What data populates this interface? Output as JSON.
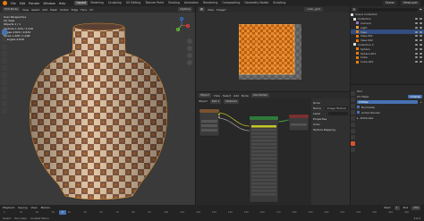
{
  "app": {
    "menu": [
      "File",
      "Edit",
      "Render",
      "Window",
      "Help"
    ],
    "tabs": [
      "Layout",
      "Modeling",
      "Sculpting",
      "UV Editing",
      "Texture Paint",
      "Shading",
      "Animation",
      "Rendering",
      "Compositing",
      "Geometry Nodes",
      "Scripting"
    ],
    "active_tab": "Layout",
    "scene": "Scene",
    "view_layer": "ViewLayer"
  },
  "viewport": {
    "header": [
      "Edit Mode",
      "View",
      "Select",
      "Add",
      "Mesh",
      "Vertex",
      "Edge",
      "Face",
      "UV"
    ],
    "info": [
      "User Perspective",
      "(0) Vase",
      "Objects   1 / 1",
      "Vertices  1,416 / 1,416",
      "Edges     2,824 / 2,824",
      "Faces     1,408 / 1,408",
      "Triangles 2,816"
    ],
    "shading": "Options",
    "gizmo": {
      "x": "X",
      "y": "Y",
      "z": "Z"
    }
  },
  "image_editor": {
    "header": [
      "Image",
      "View",
      "Image*"
    ],
    "image_name": "color_grid"
  },
  "node_editor": {
    "header": [
      "Object",
      "View",
      "Select",
      "Add",
      "Node",
      "Use Nodes"
    ],
    "sub": [
      "Object",
      "Slot 1",
      "Material"
    ],
    "nodes": {
      "image": "Image Texture",
      "bsdf": "Principled BSDF",
      "output": "Material Output"
    },
    "panel": {
      "title": "Node",
      "name_label": "Name",
      "name_value": "Image Texture",
      "label_label": "Label",
      "properties": "Properties",
      "color": "Color",
      "texture_mapping": "Texture Mapping"
    }
  },
  "outliner": {
    "title": "Scene Collection",
    "items": [
      "Collection",
      "Camera",
      "Light",
      "Vase",
      "Vase.001",
      "Vase.002",
      "Collection 2",
      "Sphere",
      "Sphere.001",
      "Cube",
      "Cube.001"
    ],
    "selected_index": 3
  },
  "properties": {
    "tool_label": "Tool",
    "uv_maps_label": "UV Maps",
    "uv_map": "UVMap",
    "uv_add": "+",
    "map_button": "Unwrap",
    "options": [
      "Normalize",
      "Active Render"
    ],
    "section": "Attributes"
  },
  "timeline": {
    "header": [
      "Playback",
      "Keying",
      "View",
      "Marker"
    ],
    "frame": "1",
    "start_label": "Start",
    "start": "1",
    "end_label": "End",
    "end": "250",
    "ticks": [
      "0",
      "10",
      "20",
      "30",
      "40",
      "50",
      "60",
      "70",
      "80",
      "90",
      "100",
      "110",
      "120",
      "130",
      "140",
      "150",
      "160",
      "170",
      "180",
      "190",
      "200",
      "210",
      "220",
      "230",
      "240",
      "250"
    ],
    "status": [
      "Select",
      "Pan View",
      "Context Menu"
    ],
    "version": "3.6.0"
  },
  "colors": {
    "accent": "#4772b3",
    "orange": "#e87d0d",
    "checker_dark": "#8a5f47",
    "checker_light": "#e4c8a8"
  }
}
